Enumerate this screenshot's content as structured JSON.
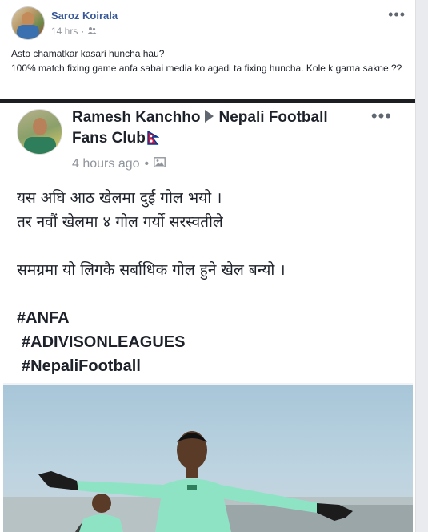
{
  "post": {
    "author": "Saroz Koirala",
    "time": "14 hrs",
    "privacy_icon": "friends-icon",
    "more_label": "•••",
    "text_lines": [
      "Asto chamatkar kasari huncha hau?",
      "100% match fixing game anfa sabai media ko agadi ta fixing huncha. Kole k garna sakne ??"
    ]
  },
  "shared": {
    "author_name": "Ramesh Kanchho",
    "page_name": "Nepali Football Fans Club",
    "time": "4 hours ago",
    "time_separator": "•",
    "media_icon": "photo-icon",
    "more_label": "•••",
    "lines": [
      "यस अघि आठ खेलमा दुई गोल भयो ।",
      "तर नवौं खेलमा ४ गोल गर्यो सरस्वतीले",
      "समग्रमा यो लिगकै सर्बाधिक गोल हुने खेल बन्यो ।"
    ],
    "hashtags": [
      "#ANFA",
      "#ADIVISONLEAGUES",
      "#NepaliFootball"
    ]
  },
  "colors": {
    "link": "#385898",
    "meta": "#90949c",
    "shirt": "#8fe3c5",
    "glove": "#1c1c1c"
  }
}
